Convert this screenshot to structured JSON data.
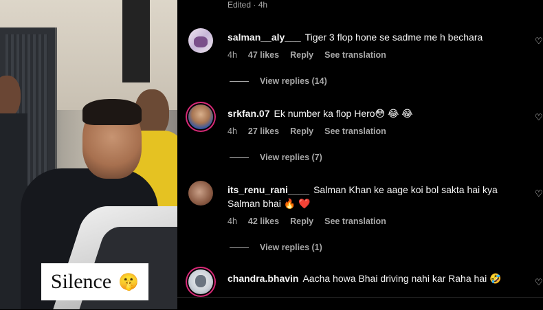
{
  "media": {
    "overlay_text": "Silence",
    "overlay_emoji": "🤫"
  },
  "header": {
    "edited_label": "Edited · 4h"
  },
  "comments": [
    {
      "username": "salman__aly___",
      "text": "Tiger 3 flop hone se sadme me h bechara",
      "time": "4h",
      "likes": "47 likes",
      "reply_label": "Reply",
      "translate_label": "See translation",
      "view_replies": "View replies (14)"
    },
    {
      "username": "srkfan.07",
      "text": "Ek number ka flop Hero😳 😂 😂",
      "time": "4h",
      "likes": "27 likes",
      "reply_label": "Reply",
      "translate_label": "See translation",
      "view_replies": "View replies (7)"
    },
    {
      "username": "its_renu_rani____",
      "text": "Salman Khan ke aage koi bol sakta hai kya Salman bhai 🔥 ❤️",
      "time": "4h",
      "likes": "42 likes",
      "reply_label": "Reply",
      "translate_label": "See translation",
      "view_replies": "View replies (1)"
    },
    {
      "username": "chandra.bhavin",
      "text": "Aacha howa Bhai driving nahi kar Raha hai 🤣"
    }
  ],
  "icons": {
    "like": "heart-icon"
  }
}
